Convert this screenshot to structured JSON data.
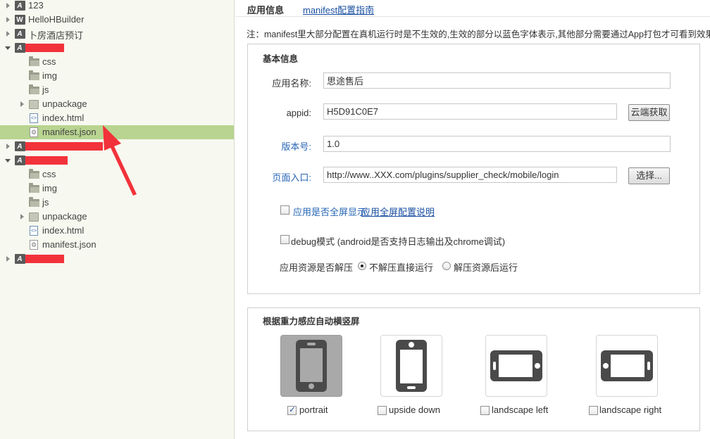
{
  "tree": {
    "rows": [
      {
        "label": "123",
        "icon": "project-a",
        "twisty": "closed",
        "indent": 0
      },
      {
        "label": "HelloHBuilder",
        "icon": "project-w",
        "twisty": "closed",
        "indent": 0
      },
      {
        "label": "卜房酒店预订",
        "icon": "project-a",
        "twisty": "closed",
        "indent": 0
      },
      {
        "label": "",
        "icon": "project-a",
        "twisty": "open",
        "indent": 0,
        "redacted": true
      },
      {
        "label": "css",
        "icon": "folder",
        "twisty": "",
        "indent": 1
      },
      {
        "label": "img",
        "icon": "folder",
        "twisty": "",
        "indent": 1
      },
      {
        "label": "js",
        "icon": "folder",
        "twisty": "",
        "indent": 1
      },
      {
        "label": "unpackage",
        "icon": "package",
        "twisty": "closed",
        "indent": 1
      },
      {
        "label": "index.html",
        "icon": "html-file",
        "twisty": "",
        "indent": 1
      },
      {
        "label": "manifest.json",
        "icon": "json-file",
        "twisty": "",
        "indent": 1,
        "selected": true
      },
      {
        "label": "",
        "icon": "project-a",
        "twisty": "closed",
        "indent": 0,
        "redacted": true
      },
      {
        "label": "",
        "icon": "project-a",
        "twisty": "open",
        "indent": 0,
        "redacted": true
      },
      {
        "label": "css",
        "icon": "folder",
        "twisty": "",
        "indent": 1
      },
      {
        "label": "img",
        "icon": "folder",
        "twisty": "",
        "indent": 1
      },
      {
        "label": "js",
        "icon": "folder",
        "twisty": "",
        "indent": 1
      },
      {
        "label": "unpackage",
        "icon": "package",
        "twisty": "closed",
        "indent": 1
      },
      {
        "label": "index.html",
        "icon": "html-file",
        "twisty": "",
        "indent": 1
      },
      {
        "label": "manifest.json",
        "icon": "json-file",
        "twisty": "",
        "indent": 1
      },
      {
        "label": "",
        "icon": "project-a",
        "twisty": "closed",
        "indent": 0,
        "redacted": true
      }
    ],
    "annotation_color": "#f2323a",
    "selection_color": "#b8d490"
  },
  "editor": {
    "tab_active": "应用信息",
    "tab_link": "manifest配置指南",
    "note": "注：manifest里大部分配置在真机运行时是不生效的,生效的部分以蓝色字体表示,其他部分需要通过App打包才可看到效果",
    "basic": {
      "title": "基本信息",
      "app_name_label": "应用名称:",
      "app_name_value": "思途售后",
      "appid_label": "appid:",
      "appid_value": "H5D91C0E7",
      "cloud_button": "云端获取",
      "version_label": "版本号:",
      "version_value": "1.0",
      "entry_label": "页面入口:",
      "entry_value": "http://www..XXX.com/plugins/supplier_check/mobile/login",
      "select_button": "选择...",
      "fullscreen_label": "应用是否全屏显示",
      "fullscreen_checked": false,
      "fullscreen_link": "应用全屏配置说明",
      "debug_label": "debug模式 (android是否支持日志输出及chrome调试)",
      "debug_checked": false,
      "unzip_label": "应用资源是否解压",
      "unzip_options": [
        "不解压直接运行",
        "解压资源后运行"
      ],
      "unzip_selected": 0
    },
    "orientation": {
      "title": "根据重力感应自动横竖屏",
      "options": [
        {
          "label": "portrait",
          "checked": true,
          "icon": "phone-portrait-icon"
        },
        {
          "label": "upside down",
          "checked": false,
          "icon": "phone-upside-down-icon"
        },
        {
          "label": "landscape left",
          "checked": false,
          "icon": "phone-landscape-left-icon"
        },
        {
          "label": "landscape right",
          "checked": false,
          "icon": "phone-landscape-right-icon"
        }
      ]
    },
    "accent_blue": "#2766b5",
    "link_blue": "#1a4fa0"
  }
}
